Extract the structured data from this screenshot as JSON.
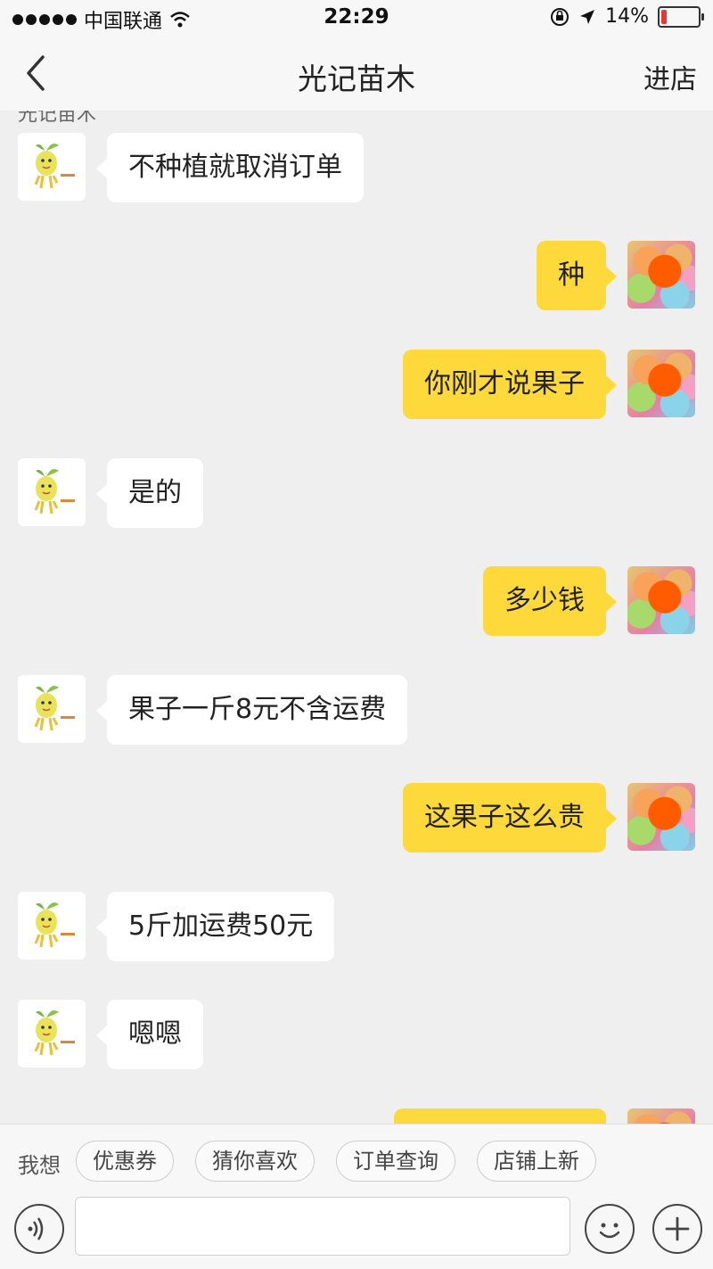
{
  "status": {
    "carrier": "中国联通",
    "time": "22:29",
    "battery": "14%",
    "battery_level": 0.14,
    "icons": [
      "signal-dots-icon",
      "wifi-icon",
      "rotation-lock-icon",
      "location-arrow-icon",
      "battery-icon"
    ]
  },
  "nav": {
    "title": "光记苗木",
    "back_icon": "chevron-left-icon",
    "action": "进店"
  },
  "chat": {
    "sender_peek": "光记苗木",
    "messages": [
      {
        "side": "left",
        "text": "不种植就取消订单"
      },
      {
        "side": "right",
        "text": "种"
      },
      {
        "side": "right",
        "text": "你刚才说果子"
      },
      {
        "side": "left",
        "text": "是的"
      },
      {
        "side": "right",
        "text": "多少钱"
      },
      {
        "side": "left",
        "text": "果子一斤8元不含运费"
      },
      {
        "side": "right",
        "text": "这果子这么贵"
      },
      {
        "side": "left",
        "text": "5斤加运费50元"
      },
      {
        "side": "left",
        "text": "嗯嗯"
      },
      {
        "side": "right",
        "text": ""
      }
    ]
  },
  "quick": {
    "label": "我想",
    "chips": [
      "优惠券",
      "猜你喜欢",
      "订单查询",
      "店铺上新"
    ]
  },
  "input": {
    "placeholder": "",
    "voice_icon": "voice-icon",
    "emoji_icon": "emoji-icon",
    "plus_icon": "plus-icon"
  },
  "colors": {
    "outgoing_bubble": "#fed93b",
    "incoming_bubble": "#ffffff",
    "background": "#efefef",
    "battery_low": "#e53935"
  }
}
